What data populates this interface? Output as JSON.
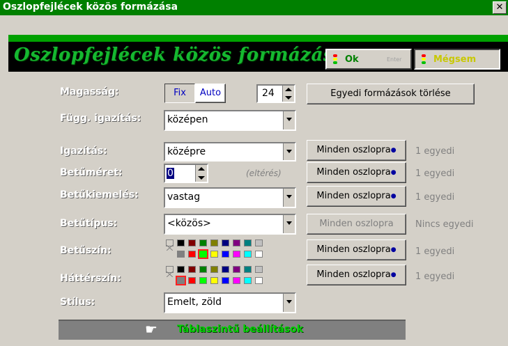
{
  "window": {
    "title": "Oszlopfejlécek közös formázása",
    "close_label": "✕"
  },
  "header": {
    "title": "Oszlopfejlécek közös formázása",
    "ok_label": "Ok",
    "enter_label": "Enter",
    "cancel_label": "Mégsem"
  },
  "height": {
    "label": "Magasság:",
    "fix_label": "Fix",
    "auto_label": "Auto",
    "value": "24",
    "clear_label": "Egyedi formázások törlése"
  },
  "valign": {
    "label": "Függ. igazítás:",
    "value": "középen"
  },
  "rows": [
    {
      "label": "Igazítás:",
      "value": "középre",
      "apply_label": "Minden oszlopra",
      "status": "1 egyedi"
    },
    {
      "label": "Betűméret:",
      "value": "0",
      "hint": "(eltérés)",
      "apply_label": "Minden oszlopra",
      "status": "1 egyedi"
    },
    {
      "label": "Betűkiemelés:",
      "value": "vastag",
      "apply_label": "Minden oszlopra",
      "status": "1 egyedi"
    },
    {
      "label": "Betűtípus:",
      "value": "<közös>",
      "apply_label": "Minden oszlopra",
      "status": "Nincs egyedi"
    },
    {
      "label": "Betűszín:",
      "apply_label": "Minden oszlopra",
      "status": "1 egyedi"
    },
    {
      "label": "Háttérszín:",
      "apply_label": "Minden oszlopra",
      "status": "1 egyedi"
    }
  ],
  "style": {
    "label": "Stílus:",
    "value": "Emelt, zöld"
  },
  "footer": {
    "label": "Táblaszintű beállítások",
    "icon": "pointing-hand-icon"
  },
  "palette": {
    "top": [
      "#000000",
      "#800000",
      "#008000",
      "#808000",
      "#000080",
      "#800080",
      "#008080",
      "#c0c0c0"
    ],
    "bottom": [
      "#808080",
      "#ff0000",
      "#00ff00",
      "#ffff00",
      "#0000ff",
      "#ff00ff",
      "#00ffff",
      "#ffffff"
    ],
    "text_selected": "#00ff00",
    "bg_selected": "#808080"
  },
  "colors": {
    "title_bar": "#008000",
    "accent_green": "#15b830",
    "dialog_bg": "#d4d0c8"
  }
}
